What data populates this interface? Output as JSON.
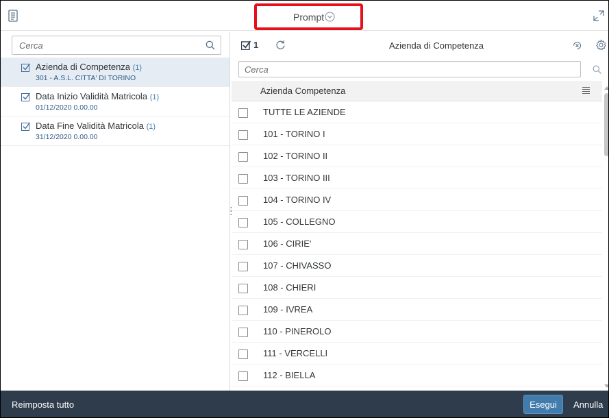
{
  "header": {
    "title": "Prompt",
    "icons": {
      "left": "document-list-icon",
      "chevron": "chevron-down-circle-icon",
      "right": "expand-icon"
    },
    "highlight_color": "#e6101a"
  },
  "left_panel": {
    "search": {
      "placeholder": "Cerca",
      "value": ""
    },
    "prompts": [
      {
        "name": "Azienda di Competenza",
        "count": "(1)",
        "value": "301 - A.S.L. CITTA' DI TORINO",
        "selected": true
      },
      {
        "name": "Data Inizio Validità Matricola",
        "count": "(1)",
        "value": "01/12/2020 0.00.00",
        "selected": false
      },
      {
        "name": "Data Fine Validità Matricola",
        "count": "(1)",
        "value": "31/12/2020 0.00.00",
        "selected": false
      }
    ]
  },
  "right_panel": {
    "selected_count": "1",
    "title": "Azienda di Competenza",
    "search": {
      "placeholder": "Cerca",
      "value": ""
    },
    "column_header": "Azienda Competenza",
    "items": [
      "TUTTE LE AZIENDE",
      "101 - TORINO I",
      "102 - TORINO II",
      "103 - TORINO III",
      "104 - TORINO IV",
      "105 - COLLEGNO",
      "106 - CIRIE'",
      "107 - CHIVASSO",
      "108 - CHIERI",
      "109 - IVREA",
      "110 - PINEROLO",
      "111 - VERCELLI",
      "112 - BIELLA"
    ]
  },
  "footer": {
    "reset_label": "Reimposta tutto",
    "run_label": "Esegui",
    "cancel_label": "Annulla"
  },
  "colors": {
    "footer_bg": "#2f3c4c",
    "accent": "#427cac",
    "selected_row_bg": "#e6ecf3"
  }
}
